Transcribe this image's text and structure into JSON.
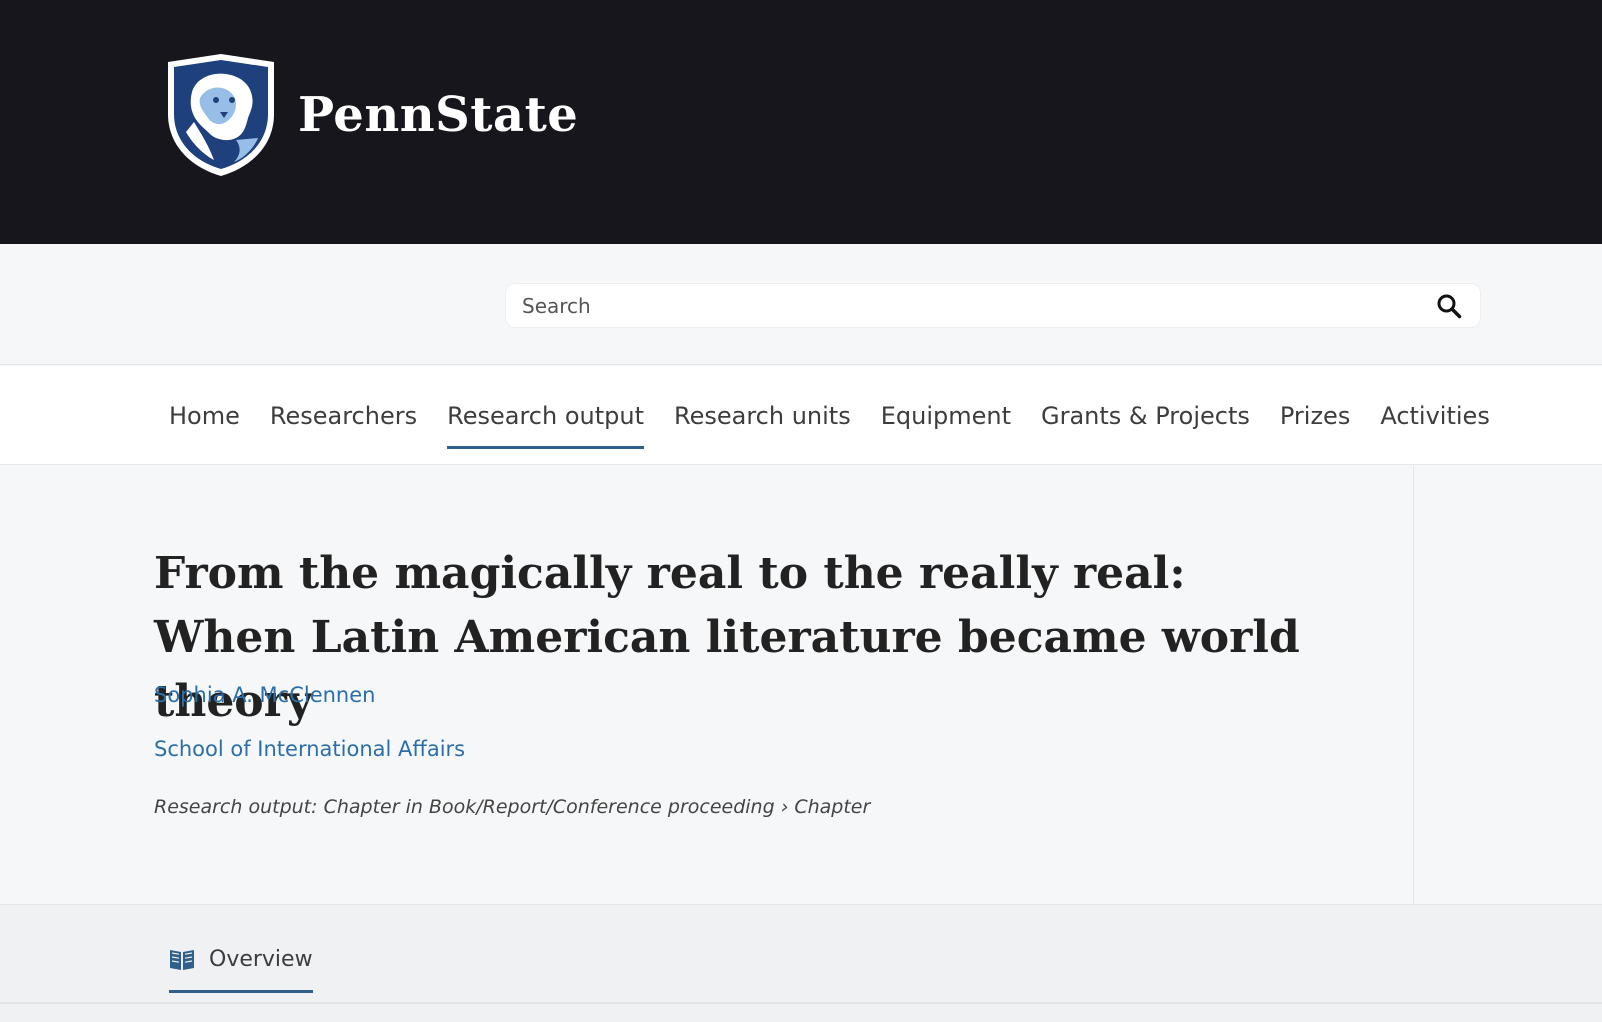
{
  "header": {
    "brand": "PennState",
    "logo_icon": "shield-lion-icon"
  },
  "search": {
    "placeholder": "Search",
    "value": ""
  },
  "nav": {
    "items": [
      {
        "label": "Home"
      },
      {
        "label": "Researchers"
      },
      {
        "label": "Research output"
      },
      {
        "label": "Research units"
      },
      {
        "label": "Equipment"
      },
      {
        "label": "Grants & Projects"
      },
      {
        "label": "Prizes"
      },
      {
        "label": "Activities"
      }
    ],
    "active_index": 2
  },
  "publication": {
    "title": "From the magically real to the really real: When Latin American literature became world theory",
    "author": "Sophia A. McClennen",
    "unit": "School of International Affairs",
    "meta": "Research output: Chapter in Book/Report/Conference proceeding › Chapter"
  },
  "tabs": {
    "overview": "Overview"
  },
  "colors": {
    "header_bg": "#17161d",
    "link": "#2c6fa8",
    "accent": "#2f5f8a"
  }
}
